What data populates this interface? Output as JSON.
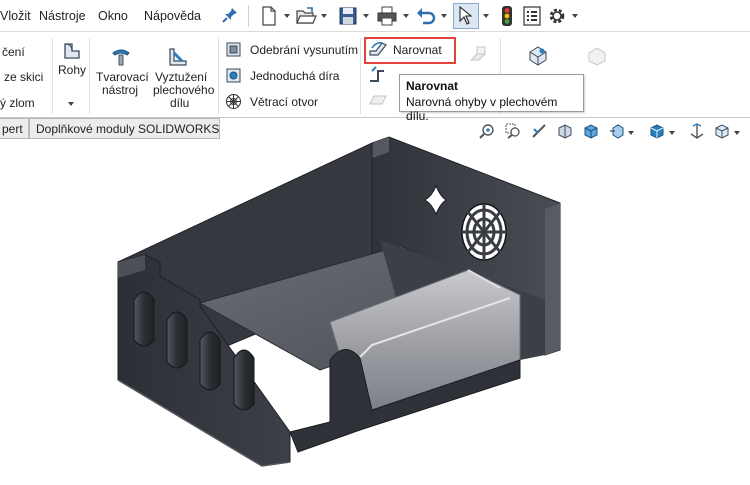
{
  "menu": {
    "items": [
      "Vložit",
      "Nástroje",
      "Okno",
      "Nápověda"
    ]
  },
  "ribbon": {
    "left_labels": [
      "čení",
      "ze skici",
      "ý zlom"
    ],
    "rohy": "Rohy",
    "tvarovaci": [
      "Tvarovací",
      "nástroj"
    ],
    "vyztuzeni": [
      "Vyztužení",
      "plechového",
      "dílu"
    ],
    "odebrani": "Odebrání vysunutím",
    "jednoducha_dira": "Jednoduchá díra",
    "vetraci_otvor": "Větrací otvor",
    "narovnat": "Narovnat"
  },
  "tooltip": {
    "title": "Narovnat",
    "description": "Narovná ohyby v plechovém dílu."
  },
  "tabs": {
    "left": "pert",
    "addins": "Doplňkové moduly SOLIDWORKS"
  },
  "colors": {
    "highlight": "#e0443a",
    "metal_dark": "#3a3d44",
    "metal_light": "#a9aab0"
  }
}
